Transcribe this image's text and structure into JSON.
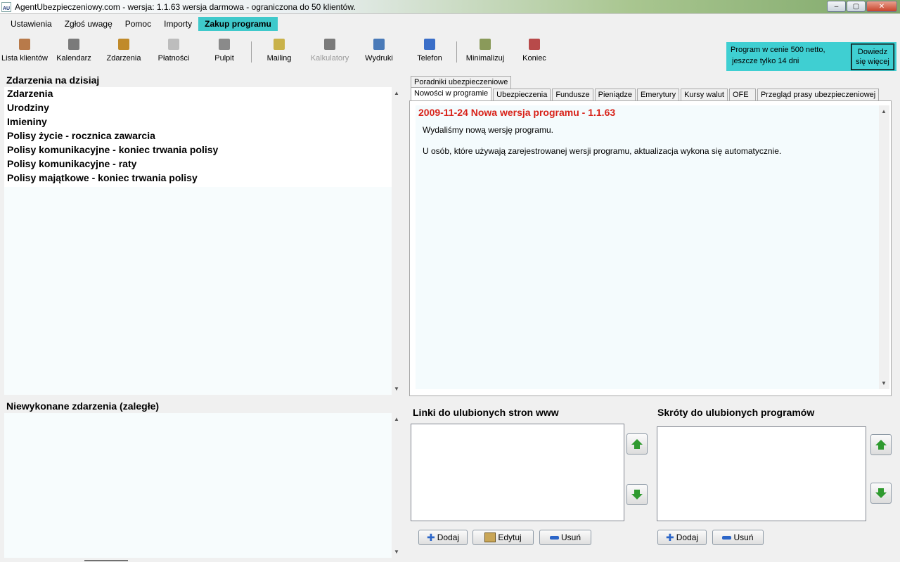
{
  "window": {
    "icon_text": "AU",
    "title": "AgentUbezpieczeniowy.com - wersja: 1.1.63 wersja darmowa - ograniczona do 50 klientów.",
    "buttons": {
      "minimize": "–",
      "maximize": "▢",
      "close": "✕"
    }
  },
  "menu": [
    "Ustawienia",
    "Zgłoś uwagę",
    "Pomoc",
    "Importy",
    "Zakup programu"
  ],
  "toolbar": {
    "items": [
      {
        "label": "Lista klientów",
        "icon": "clients-icon",
        "color": "#b87a4a",
        "disabled": false
      },
      {
        "label": "Kalendarz",
        "icon": "calendar-icon",
        "color": "#7a7a7a",
        "disabled": false
      },
      {
        "label": "Zdarzenia",
        "icon": "clock-icon",
        "color": "#c08a2a",
        "disabled": false
      },
      {
        "label": "Płatności",
        "icon": "payments-icon",
        "color": "#bdbdbd",
        "disabled": false
      },
      {
        "label": "Pulpit",
        "icon": "desktop-icon",
        "color": "#8a8a8a",
        "disabled": false
      },
      {
        "label": "Mailing",
        "icon": "mail-icon",
        "color": "#c9b24a",
        "disabled": false
      },
      {
        "label": "Kalkulatory",
        "icon": "calculator-icon",
        "color": "#7a7a7a",
        "disabled": true
      },
      {
        "label": "Wydruki",
        "icon": "print-icon",
        "color": "#4a7ab8",
        "disabled": false
      },
      {
        "label": "Telefon",
        "icon": "phone-sync-icon",
        "color": "#3a6ec8",
        "disabled": false
      },
      {
        "label": "Minimalizuj",
        "icon": "minimize-icon",
        "color": "#8a9a5a",
        "disabled": false
      },
      {
        "label": "Koniec",
        "icon": "exit-icon",
        "color": "#b84a4a",
        "disabled": false
      }
    ]
  },
  "promo": {
    "line1": "Program w cenie 500 netto,",
    "line2": "jeszcze tylko 14 dni",
    "button_line1": "Dowiedz",
    "button_line2": "się więcej"
  },
  "events_today": {
    "title": "Zdarzenia na dzisiaj",
    "items": [
      "Zdarzenia",
      "Urodziny",
      "Imieniny",
      "Polisy życie - rocznica zawarcia",
      "Polisy komunikacyjne - koniec trwania polisy",
      "Polisy komunikacyjne - raty",
      "Polisy majątkowe - koniec trwania polisy"
    ]
  },
  "overdue": {
    "title": "Niewykonane zdarzenia (zaległe)"
  },
  "tabs": {
    "top_row": [
      "Poradniki ubezpieczeniowe"
    ],
    "bottom_row": [
      "Nowości w programie",
      "Ubezpieczenia",
      "Fundusze",
      "Pieniądze",
      "Emerytury",
      "Kursy walut",
      "OFE",
      "Przegląd prasy ubezpieczeniowej"
    ]
  },
  "news": {
    "heading": "2009-11-24 Nowa wersja programu - 1.1.63",
    "p1": "Wydaliśmy nową wersję programu.",
    "p2": "U osób, które używają zarejestrowanej wersji programu, aktualizacja wykona się automatycznie."
  },
  "links": {
    "title": "Linki do ulubionych stron www",
    "add": "Dodaj",
    "edit": "Edytuj",
    "remove": "Usuń"
  },
  "shortcuts": {
    "title": "Skróty do ulubionych programów",
    "add": "Dodaj",
    "remove": "Usuń"
  },
  "colors": {
    "accent": "#3fc9cb",
    "news_heading": "#d8231a",
    "arrow_green": "#2f9a2f"
  }
}
